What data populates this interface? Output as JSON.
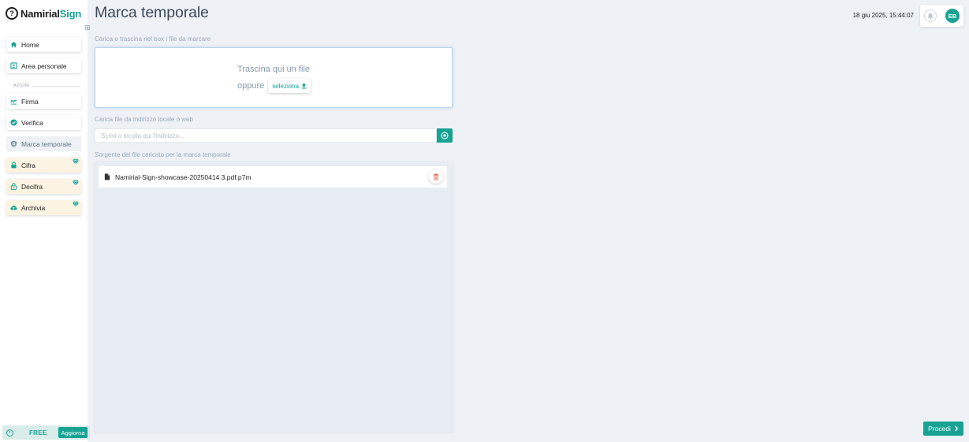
{
  "app": {
    "logo_mark": "?",
    "logo_part1": "Namirial",
    "logo_part2": "Sign"
  },
  "sidebar": {
    "items": [
      {
        "label": "Home",
        "icon": "home-icon"
      },
      {
        "label": "Area personale",
        "icon": "user-card-icon"
      }
    ],
    "section_label": "AZIONI",
    "actions": [
      {
        "label": "Firma",
        "icon": "signature-icon"
      },
      {
        "label": "Verifica",
        "icon": "check-badge-icon"
      },
      {
        "label": "Marca temporale",
        "icon": "shield-icon",
        "active": true
      },
      {
        "label": "Cifra",
        "icon": "lock-icon",
        "premium": true
      },
      {
        "label": "Decifra",
        "icon": "unlock-icon",
        "premium": true
      },
      {
        "label": "Archivia",
        "icon": "cloud-upload-icon",
        "premium": true
      }
    ],
    "plan": {
      "label": "FREE",
      "upgrade_label": "Aggiorna"
    }
  },
  "header": {
    "title": "Marca temporale",
    "datetime": "18 giu 2025, 15:44:07",
    "avatar_initials": "EB"
  },
  "upload": {
    "drop_label": "Carica o trascina nel box i file da marcare",
    "drop_title": "Trascina qui un file",
    "drop_or": "oppure",
    "select_label": "seleziona",
    "url_label": "Carica file da indirizzo locale o web",
    "url_placeholder": "Scrivi o incolla qui l'indirizzo..."
  },
  "files": {
    "label": "Sorgente del file caricato per la marca temporale",
    "items": [
      {
        "name": "Namirial-Sign-showcase-20250414 3.pdf.p7m"
      }
    ]
  },
  "footer": {
    "proceed_label": "Procedi"
  },
  "colors": {
    "accent": "#16a394",
    "background": "#eef1f6",
    "premium_bg": "#fcf3e2",
    "delete": "#e05a4a"
  }
}
